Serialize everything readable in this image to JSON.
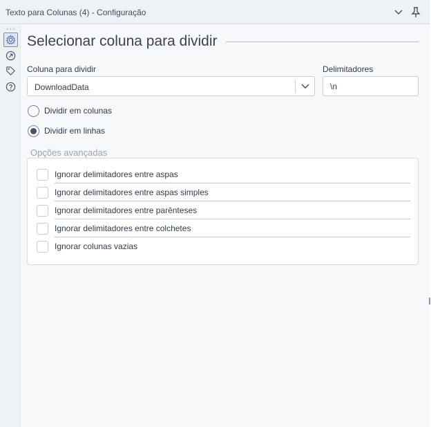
{
  "window": {
    "title": "Texto para Colunas (4) - Configuração"
  },
  "rail": {
    "dots": "···",
    "items": [
      {
        "icon": "gear-icon",
        "active": true
      },
      {
        "icon": "connection-icon",
        "active": false
      },
      {
        "icon": "tag-icon",
        "active": false
      },
      {
        "icon": "help-icon",
        "active": false
      }
    ]
  },
  "main": {
    "section_title": "Selecionar coluna para dividir",
    "column_label": "Coluna para dividir",
    "column_value": "DownloadData",
    "delimiters_label": "Delimitadores",
    "delimiters_value": "\\n",
    "radios": [
      {
        "label": "Dividir em colunas",
        "checked": false
      },
      {
        "label": "Dividir em linhas",
        "checked": true
      }
    ],
    "advanced_title": "Opções avançadas",
    "checkboxes": [
      {
        "label": "Ignorar delimitadores entre aspas",
        "checked": false
      },
      {
        "label": "Ignorar delimitadores entre aspas simples",
        "checked": false
      },
      {
        "label": "Ignorar delimitadores entre parênteses",
        "checked": false
      },
      {
        "label": "Ignorar delimitadores entre colchetes",
        "checked": false
      },
      {
        "label": "Ignorar colunas vazias",
        "checked": false
      }
    ]
  },
  "colors": {
    "accent": "#6b8fc2",
    "panel_bg": "#f7f8fa",
    "titlebar_bg": "#eef1f6"
  }
}
